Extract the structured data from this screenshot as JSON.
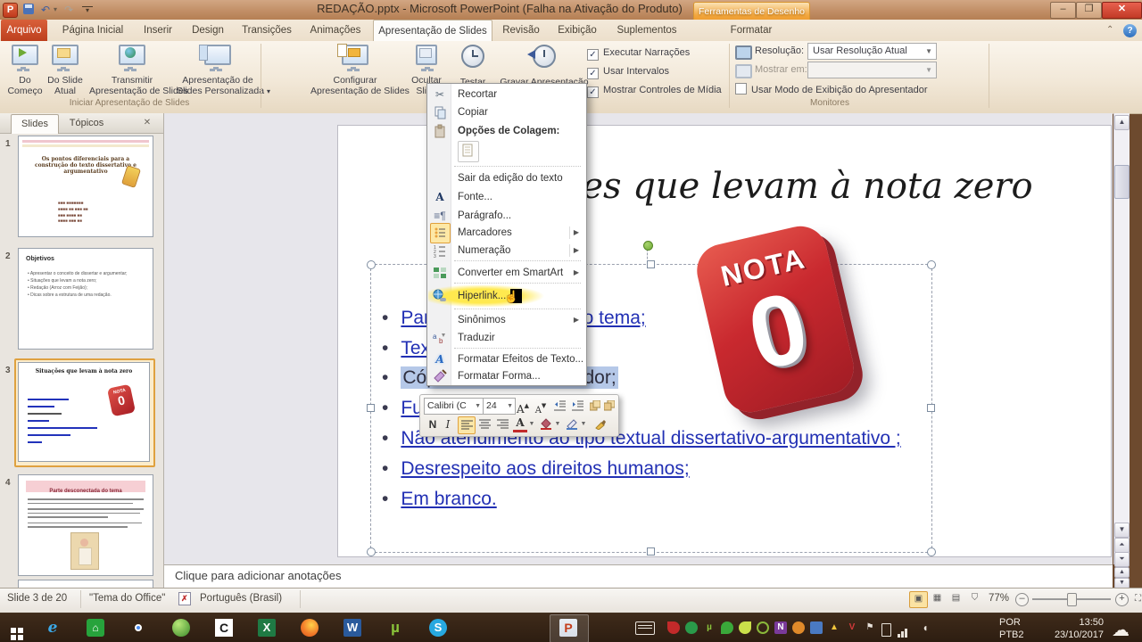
{
  "window": {
    "title": "REDAÇÃO.pptx - Microsoft PowerPoint (Falha na Ativação do Produto)",
    "contextual_tab_group": "Ferramentas de Desenho"
  },
  "ribbon": {
    "tabs": [
      "Arquivo",
      "Página Inicial",
      "Inserir",
      "Design",
      "Transições",
      "Animações",
      "Apresentação de Slides",
      "Revisão",
      "Exibição",
      "Suplementos",
      "Formatar"
    ],
    "active_tab": "Apresentação de Slides",
    "start_group": {
      "label": "Iniciar Apresentação de Slides",
      "from_beginning_line1": "Do",
      "from_beginning_line2": "Começo",
      "from_current_line1": "Do Slide",
      "from_current_line2": "Atual",
      "broadcast_line1": "Transmitir",
      "broadcast_line2": "Apresentação de Slides",
      "custom_line1": "Apresentação de",
      "custom_line2": "Slides Personalizada"
    },
    "setup_group": {
      "setup_line1": "Configurar",
      "setup_line2": "Apresentação de Slides",
      "hide_line1": "Ocultar",
      "hide_line2": "Slide",
      "rehearse": "Testar",
      "record": "Gravar Apresentação",
      "checkboxes": [
        {
          "label": "Executar Narrações",
          "checked": true
        },
        {
          "label": "Usar Intervalos",
          "checked": true
        },
        {
          "label": "Mostrar Controles de Mídia",
          "checked": true
        }
      ]
    },
    "monitors_group": {
      "label": "Monitores",
      "resolution_label": "Resolução:",
      "resolution_value": "Usar Resolução Atual",
      "show_on_label": "Mostrar em:",
      "presenter_checkbox": "Usar Modo de Exibição do Apresentador"
    }
  },
  "sidebar": {
    "tabs": [
      "Slides",
      "Tópicos"
    ],
    "thumbnails": [
      {
        "number": "1",
        "title": "Os pontos diferenciais para a construção do texto dissertativo e argumentativo"
      },
      {
        "number": "2",
        "title": "Objetivos",
        "bullets": [
          "Apresentar o conceito de dissertar e argumentar;",
          "Situações que levam a nota zero;",
          "Redação (Arroz com Feijão);",
          "Dicas sobre a estrutura de uma redação."
        ]
      },
      {
        "number": "3",
        "title": "Situações que levam à nota zero",
        "badge_line1": "NOTA",
        "badge_line2": "0"
      },
      {
        "number": "4",
        "title": "Parte desconectada do tema"
      }
    ]
  },
  "slide": {
    "title": "Situações que levam à nota zero",
    "badge_line1": "NOTA",
    "badge_line2": "0",
    "bullets": [
      {
        "text": "Parte desconectada do tema;",
        "style": "link"
      },
      {
        "text": "Texto insuficiente;",
        "style": "link"
      },
      {
        "text": "Cópia de texto motivador;",
        "style": "selected"
      },
      {
        "text": "Fuga ao Tema;",
        "style": "link"
      },
      {
        "text": "Não atendimento ao tipo textual dissertativo-argumentativo ;",
        "style": "link"
      },
      {
        "text": "Desrespeito aos direitos humanos;",
        "style": "link"
      },
      {
        "text": "Em branco.",
        "style": "link"
      }
    ]
  },
  "context_menu": {
    "items": [
      {
        "label": "Recortar"
      },
      {
        "label": "Copiar"
      },
      {
        "label": "Opções de Colagem:"
      },
      {
        "label": "Sair da edição do texto"
      },
      {
        "label": "Fonte..."
      },
      {
        "label": "Parágrafo..."
      },
      {
        "label": "Marcadores"
      },
      {
        "label": "Numeração"
      },
      {
        "label": "Converter em SmartArt"
      },
      {
        "label": "Hiperlink..."
      },
      {
        "label": "Sinônimos"
      },
      {
        "label": "Traduzir"
      },
      {
        "label": "Formatar Efeitos de Texto..."
      },
      {
        "label": "Formatar Forma..."
      }
    ]
  },
  "mini_toolbar": {
    "font_name": "Calibri (C",
    "font_size": "24",
    "bold": "N",
    "italic": "I"
  },
  "notes": {
    "placeholder": "Clique para adicionar anotações"
  },
  "status_bar": {
    "slide_indicator": "Slide 3 de 20",
    "theme": "\"Tema do Office\"",
    "language": "Português (Brasil)",
    "zoom_level": "77%"
  },
  "taskbar": {
    "language_line1": "POR",
    "language_line2": "PTB2",
    "time": "13:50",
    "date": "23/10/2017"
  },
  "colors": {
    "accent_orange": "#f0a23c",
    "hyperlink_blue": "#2230b4",
    "nota_red": "#c9292f",
    "file_tab_red": "#bd3f1e"
  }
}
